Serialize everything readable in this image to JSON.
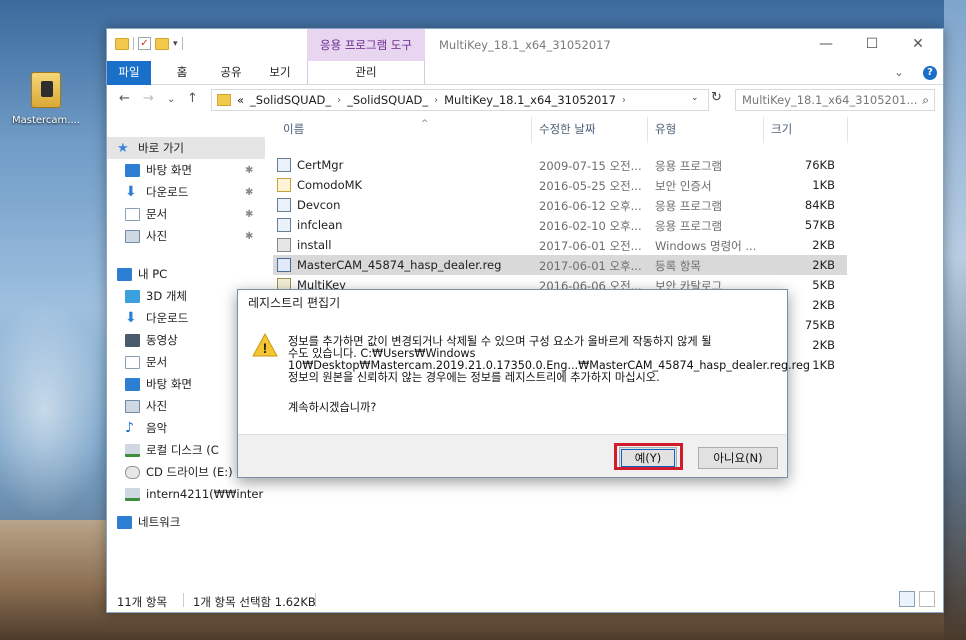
{
  "desktop": {
    "icon_label": "Mastercam...."
  },
  "window": {
    "title": "MultiKey_18.1_x64_31052017",
    "context_tab": "응용 프로그램 도구",
    "context_subtab": "관리",
    "controls": {
      "minimize": "—",
      "maximize": "☐",
      "close": "✕"
    }
  },
  "ribbon": {
    "tabs": [
      "파일",
      "홈",
      "공유",
      "보기"
    ],
    "expand": "⌄",
    "help": "?"
  },
  "address": {
    "nav": {
      "back": "←",
      "forward": "→",
      "recent": "⌄",
      "up": "↑"
    },
    "prefix": "«",
    "crumbs": [
      "_SolidSQUAD_",
      "_SolidSQUAD_",
      "MultiKey_18.1_x64_31052017"
    ],
    "separator": "›",
    "dropdown": "⌄",
    "refresh": "↻",
    "search_placeholder": "MultiKey_18.1_x64_3105201...",
    "search_glyph": "⌕"
  },
  "navpane": {
    "items": [
      {
        "label": "바로 가기",
        "icon": "star-icon",
        "color": "#3a86d8"
      },
      {
        "label": "바탕 화면",
        "icon": "desktop-icon",
        "color": "#2d7fd3",
        "pinned": true
      },
      {
        "label": "다운로드",
        "icon": "download-icon",
        "color": "#2d7fd3",
        "pinned": true
      },
      {
        "label": "문서",
        "icon": "document-icon",
        "color": "#8aa0b8",
        "pinned": true
      },
      {
        "label": "사진",
        "icon": "pictures-icon",
        "color": "#6f8aa5",
        "pinned": true
      },
      {
        "label": "내 PC",
        "icon": "pc-icon",
        "color": "#2d7fd3"
      },
      {
        "label": "3D 개체",
        "icon": "cube-icon",
        "color": "#3aa0e0"
      },
      {
        "label": "다운로드",
        "icon": "download-icon",
        "color": "#2d7fd3"
      },
      {
        "label": "동영상",
        "icon": "video-icon",
        "color": "#4a5a6a"
      },
      {
        "label": "문서",
        "icon": "document-icon",
        "color": "#8aa0b8"
      },
      {
        "label": "바탕 화면",
        "icon": "desktop-icon",
        "color": "#2d7fd3"
      },
      {
        "label": "사진",
        "icon": "pictures-icon",
        "color": "#6f8aa5"
      },
      {
        "label": "음악",
        "icon": "music-icon",
        "color": "#1c6fd0"
      },
      {
        "label": "로컬 디스크 (C",
        "icon": "drive-icon",
        "color": "#6f8aa5"
      },
      {
        "label": "CD 드라이브 (E:) M",
        "icon": "cd-drive-icon",
        "color": "#9aa"
      },
      {
        "label": "intern4211(₩₩inter",
        "icon": "network-drive-icon",
        "color": "#3c8f3c"
      },
      {
        "label": "네트워크",
        "icon": "network-icon",
        "color": "#2d7fd3"
      }
    ],
    "pin_glyph": "✱"
  },
  "columns": {
    "name": "이름",
    "date": "수정한 날짜",
    "type": "유형",
    "size": "크기",
    "sort_glyph": "^"
  },
  "files": [
    {
      "name": "CertMgr",
      "date": "2009-07-15 오전...",
      "type": "응용 프로그램",
      "size": "76KB",
      "icon": "app-icon"
    },
    {
      "name": "ComodoMK",
      "date": "2016-05-25 오전...",
      "type": "보안 인증서",
      "size": "1KB",
      "icon": "certificate-icon"
    },
    {
      "name": "Devcon",
      "date": "2016-06-12 오후...",
      "type": "응용 프로그램",
      "size": "84KB",
      "icon": "app-icon"
    },
    {
      "name": "infclean",
      "date": "2016-02-10 오후...",
      "type": "응용 프로그램",
      "size": "57KB",
      "icon": "app-icon"
    },
    {
      "name": "install",
      "date": "2017-06-01 오전...",
      "type": "Windows 명령어 ...",
      "size": "2KB",
      "icon": "batch-icon"
    },
    {
      "name": "MasterCAM_45874_hasp_dealer.reg",
      "date": "2017-06-01 오후...",
      "type": "등록 항목",
      "size": "2KB",
      "icon": "registry-icon",
      "selected": true
    },
    {
      "name": "MultiKey",
      "date": "2016-06-06 오전...",
      "type": "보안 카탈로그",
      "size": "5KB",
      "icon": "catalog-icon"
    },
    {
      "name": "",
      "date": "",
      "type": "",
      "size": "2KB",
      "icon": ""
    },
    {
      "name": "",
      "date": "",
      "type": "",
      "size": "75KB",
      "icon": ""
    },
    {
      "name": "",
      "date": "",
      "type": "",
      "size": "2KB",
      "icon": ""
    },
    {
      "name": "",
      "date": "",
      "type": "",
      "size": "1KB",
      "icon": ""
    }
  ],
  "status": {
    "count": "11개 항목",
    "selection": "1개 항목 선택함 1.62KB"
  },
  "dialog": {
    "title": "레지스트리 편집기",
    "lines": [
      "정보를 추가하면 값이 변경되거나 삭제될 수 있으며 구성 요소가 올바르게 작동하지 않게 될",
      "수도 있습니다. C:₩Users₩Windows",
      "10₩Desktop₩Mastercam.2019.21.0.17350.0.Eng...₩MasterCAM_45874_hasp_dealer.reg.reg",
      "정보의 원본을 신뢰하지 않는 경우에는 정보를 레지스트리에 추가하지 마십시오."
    ],
    "question": "계속하시겠습니까?",
    "yes_label": "예(Y)",
    "no_label": "아니요(N)",
    "warning_glyph": "!"
  },
  "colors": {
    "accent": "#1a6fc9",
    "highlight": "#d11a2a",
    "context": "#e8d6f0"
  }
}
